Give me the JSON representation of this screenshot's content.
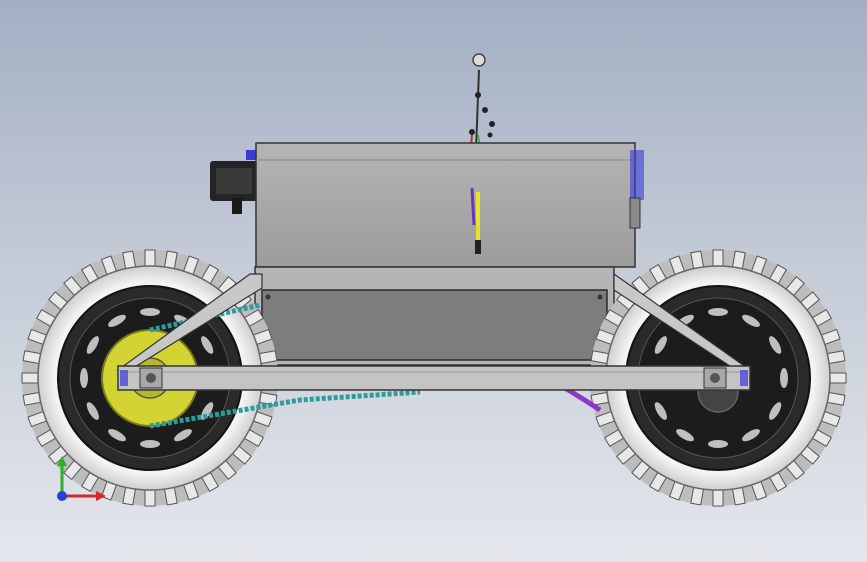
{
  "viewport": {
    "background_top": "#a2afc3",
    "background_bottom": "#e4e7ec"
  },
  "model": {
    "body_color": "#a9a9a9",
    "panel_color": "#7d7d7d",
    "frame_color": "#c2c2c2",
    "tire_color": "#ececec",
    "rim_color": "#1e1e1e",
    "sprocket_color": "#d3d433",
    "chain_color": "#2f9b9b",
    "accent_color": "#3a3ad8"
  },
  "triad": {
    "icon": "coordinate-triad-icon",
    "x_color": "#d42a2a",
    "y_color": "#2bb02b",
    "z_color": "#2a3fd4"
  }
}
